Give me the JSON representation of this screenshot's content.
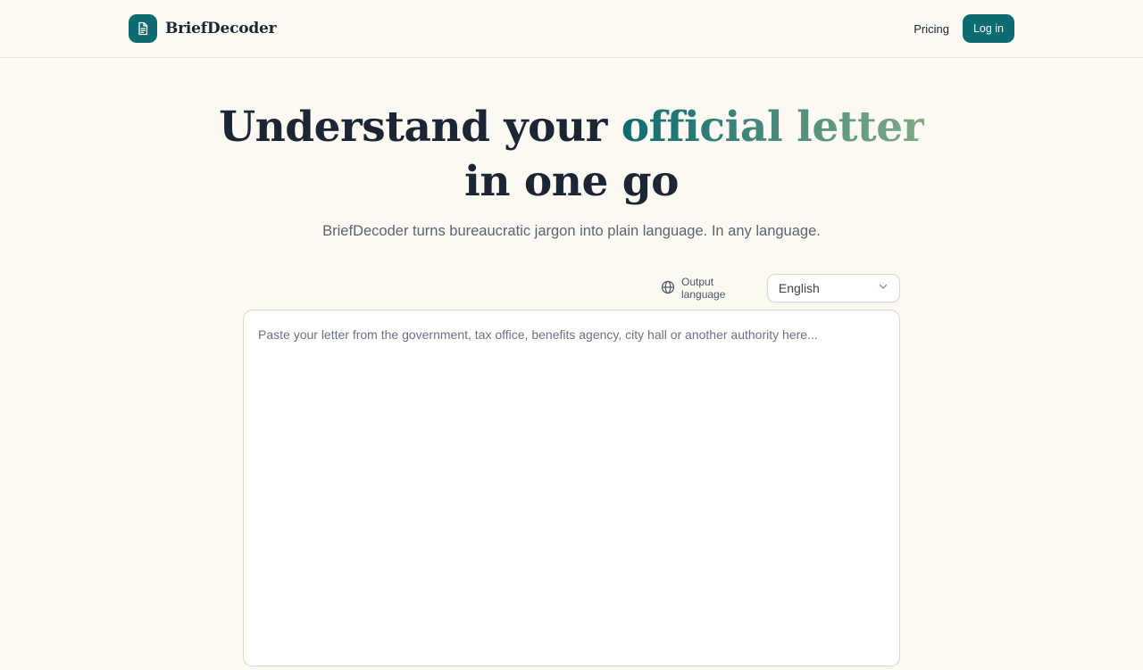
{
  "brand": {
    "name": "BriefDecoder",
    "logo_icon": "document-icon",
    "accent_color": "#0f6b72"
  },
  "nav": {
    "pricing_label": "Pricing",
    "login_label": "Log in"
  },
  "hero": {
    "title_before": "Understand your ",
    "title_accent": "official letter",
    "title_after": " in one go",
    "subtitle": "BriefDecoder turns bureaucratic jargon into plain language. In any language."
  },
  "language": {
    "label": "Output language",
    "selected": "English",
    "icon": "globe-icon",
    "dropdown_icon": "chevron-down-icon"
  },
  "letter_input": {
    "value": "",
    "placeholder": "Paste your letter from the government, tax office, benefits agency, city hall or another authority here..."
  }
}
